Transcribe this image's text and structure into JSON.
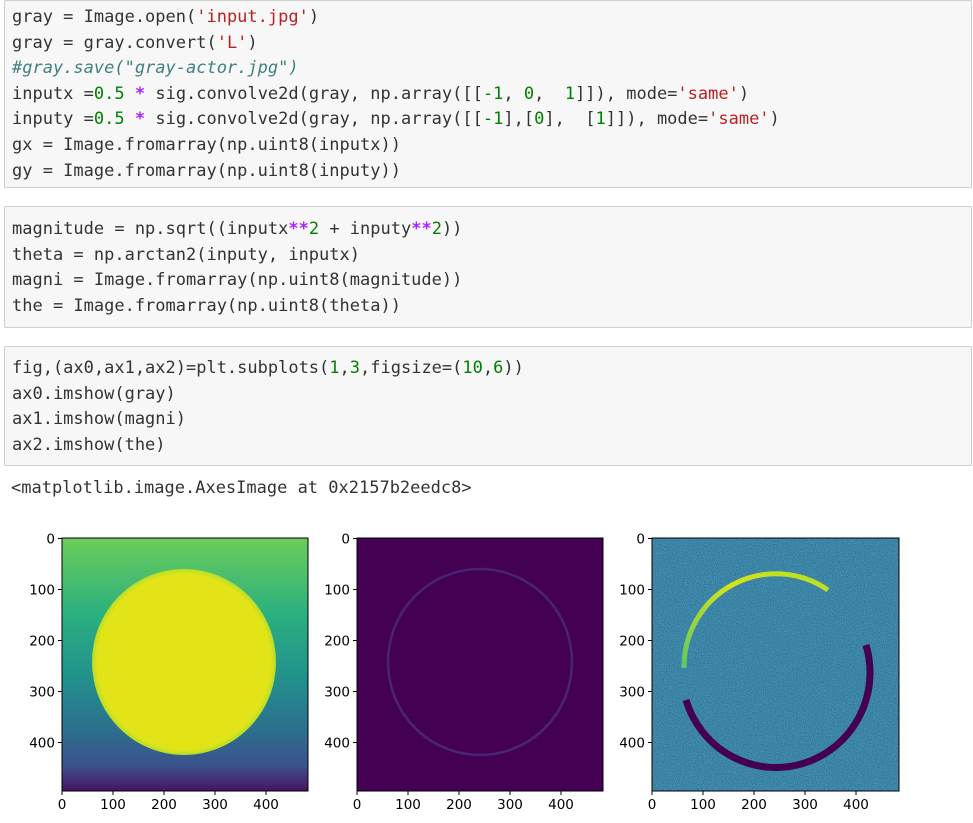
{
  "cells": [
    {
      "lines": [
        [
          {
            "t": "gray = Image.open("
          },
          {
            "t": "'input.jpg'",
            "c": "str"
          },
          {
            "t": ")"
          }
        ],
        [
          {
            "t": "gray = gray.convert("
          },
          {
            "t": "'L'",
            "c": "str"
          },
          {
            "t": ")"
          }
        ],
        [
          {
            "t": "#gray.save(\"gray-actor.jpg\")",
            "c": "com"
          }
        ],
        [
          {
            "t": "inputx ="
          },
          {
            "t": "0.5",
            "c": "num"
          },
          {
            "t": " "
          },
          {
            "t": "*",
            "c": "op"
          },
          {
            "t": " sig.convolve2d(gray, np.array([["
          },
          {
            "t": "-1",
            "c": "num"
          },
          {
            "t": ", "
          },
          {
            "t": "0",
            "c": "num"
          },
          {
            "t": ",  "
          },
          {
            "t": "1",
            "c": "num"
          },
          {
            "t": "]]), mode="
          },
          {
            "t": "'same'",
            "c": "str"
          },
          {
            "t": ")"
          }
        ],
        [
          {
            "t": "inputy ="
          },
          {
            "t": "0.5",
            "c": "num"
          },
          {
            "t": " "
          },
          {
            "t": "*",
            "c": "op"
          },
          {
            "t": " sig.convolve2d(gray, np.array([["
          },
          {
            "t": "-1",
            "c": "num"
          },
          {
            "t": "],["
          },
          {
            "t": "0",
            "c": "num"
          },
          {
            "t": "],  ["
          },
          {
            "t": "1",
            "c": "num"
          },
          {
            "t": "]]), mode="
          },
          {
            "t": "'same'",
            "c": "str"
          },
          {
            "t": ")"
          }
        ],
        [
          {
            "t": "gx = Image.fromarray(np.uint8(inputx))"
          }
        ],
        [
          {
            "t": "gy = Image.fromarray(np.uint8(inputy))"
          }
        ]
      ]
    },
    {
      "lines": [
        [
          {
            "t": "magnitude = np.sqrt((inputx"
          },
          {
            "t": "**",
            "c": "op"
          },
          {
            "t": "2",
            "c": "num"
          },
          {
            "t": " + inputy"
          },
          {
            "t": "**",
            "c": "op"
          },
          {
            "t": "2",
            "c": "num"
          },
          {
            "t": "))"
          }
        ],
        [
          {
            "t": "theta = np.arctan2(inputy, inputx)"
          }
        ],
        [
          {
            "t": "magni = Image.fromarray(np.uint8(magnitude))"
          }
        ],
        [
          {
            "t": "the = Image.fromarray(np.uint8(theta))"
          }
        ]
      ]
    },
    {
      "lines": [
        [
          {
            "t": "fig,(ax0,ax1,ax2)=plt.subplots("
          },
          {
            "t": "1",
            "c": "num"
          },
          {
            "t": ","
          },
          {
            "t": "3",
            "c": "num"
          },
          {
            "t": ",figsize=("
          },
          {
            "t": "10",
            "c": "num"
          },
          {
            "t": ","
          },
          {
            "t": "6",
            "c": "num"
          },
          {
            "t": "))"
          }
        ],
        [
          {
            "t": "ax0.imshow(gray)"
          }
        ],
        [
          {
            "t": "ax1.imshow(magni)"
          }
        ],
        [
          {
            "t": "ax2.imshow(the)"
          }
        ]
      ]
    }
  ],
  "output_text": "<matplotlib.image.AxesImage at 0x2157b2eedc8>",
  "axes_ticks": {
    "x": [
      "0",
      "100",
      "200",
      "300",
      "400"
    ],
    "y": [
      "0",
      "100",
      "200",
      "300",
      "400"
    ]
  },
  "colors": {
    "cell_bg": "#f7f7f7",
    "viridis_dark": "#440154",
    "viridis_yellow": "#e2e418"
  }
}
